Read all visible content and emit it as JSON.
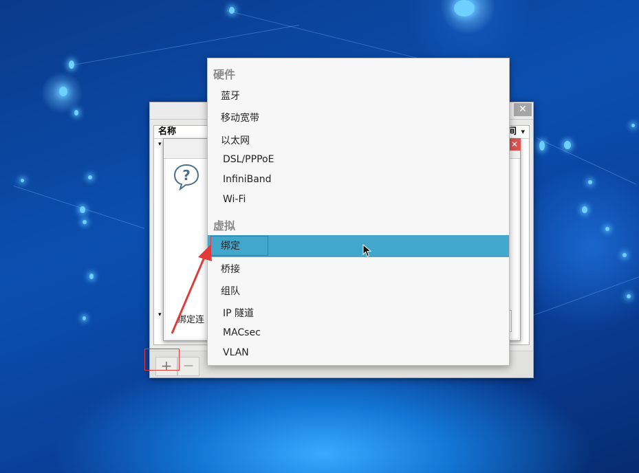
{
  "window": {
    "close_glyph": "✕",
    "column_name": "名称",
    "column_right": "间",
    "sort_arrow": "▾",
    "expander_open": "▾",
    "add_button": "+",
    "remove_button": "—",
    "partial_label": "绑定连"
  },
  "dialog": {
    "close_glyph": "✕",
    "icon": "question-icon"
  },
  "menu": {
    "header_hardware": "硬件",
    "header_virtual": "虚拟",
    "items": [
      {
        "label": "蓝牙"
      },
      {
        "label": "移动宽带"
      },
      {
        "label": "以太网"
      },
      {
        "label": "DSL/PPPoE"
      },
      {
        "label": "InfiniBand"
      },
      {
        "label": "Wi-Fi"
      },
      {
        "label": "绑定"
      },
      {
        "label": "桥接"
      },
      {
        "label": "组队"
      },
      {
        "label": "IP 隧道"
      },
      {
        "label": "MACsec"
      },
      {
        "label": "VLAN"
      }
    ],
    "selected": "绑定"
  },
  "colors": {
    "selection": "#43a7cc",
    "annotation": "#e03a3a",
    "dialog_close": "#d9534f"
  }
}
